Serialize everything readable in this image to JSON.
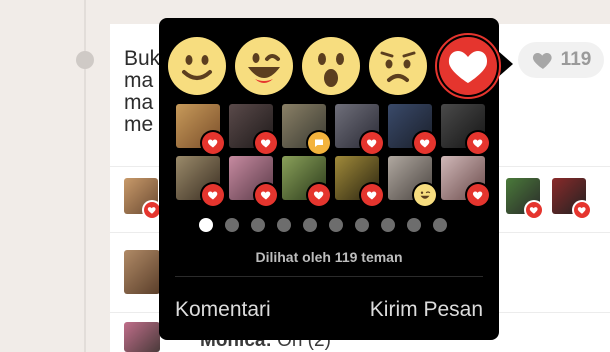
{
  "post": {
    "text_lines": [
      "Buk",
      "ma",
      "ma",
      "me"
    ],
    "reaction_count": "119"
  },
  "comment": {
    "author": "Monica:",
    "text": "Oh (2)"
  },
  "popup": {
    "reactions": [
      {
        "name": "smile",
        "selected": false
      },
      {
        "name": "laugh",
        "selected": false
      },
      {
        "name": "wow",
        "selected": false
      },
      {
        "name": "sad",
        "selected": false
      },
      {
        "name": "love",
        "selected": true
      }
    ],
    "viewers_row1": [
      "love",
      "love",
      "comment",
      "love",
      "love",
      "love"
    ],
    "viewers_row2": [
      "love",
      "love",
      "love",
      "love",
      "wink",
      "love"
    ],
    "page_dots": 10,
    "active_dot": 0,
    "seen_by": "Dilihat oleh 119 teman",
    "actions": {
      "comment": "Komentari",
      "message": "Kirim Pesan"
    }
  },
  "colors": {
    "love": "#e5352e",
    "emoji_face": "#f7dd7f",
    "comment_badge": "#f3b33d"
  }
}
